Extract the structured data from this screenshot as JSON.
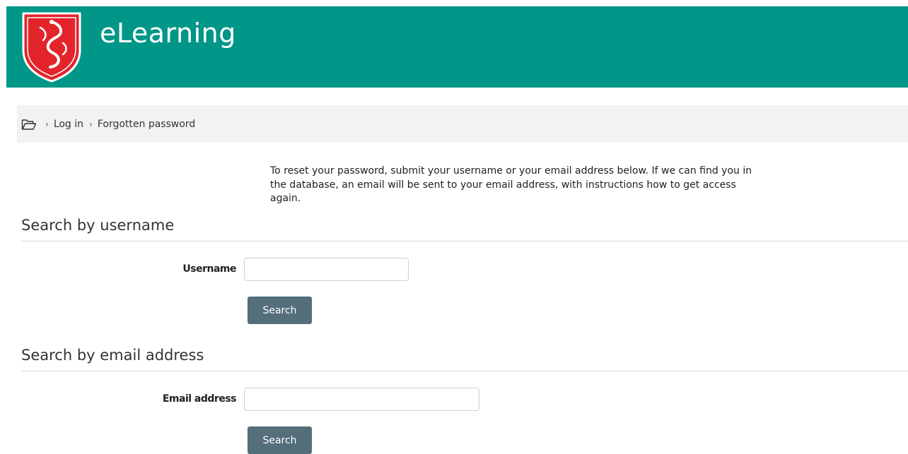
{
  "header": {
    "site_title": "eLearning",
    "logo_icon": "university-crest-icon",
    "brand_color": "#009688"
  },
  "breadcrumb": {
    "home_icon": "folder-icon",
    "items": [
      "Log in",
      "Forgotten password"
    ],
    "separator": "›"
  },
  "intro_text": "To reset your password, submit your username or your email address below. If we can find you in the database, an email will be sent to your email address, with instructions how to get access again.",
  "username_section": {
    "heading": "Search by username",
    "field_label": "Username",
    "field_value": "",
    "button_label": "Search"
  },
  "email_section": {
    "heading": "Search by email address",
    "field_label": "Email address",
    "field_value": "",
    "button_label": "Search"
  },
  "button_color": "#546e7a"
}
